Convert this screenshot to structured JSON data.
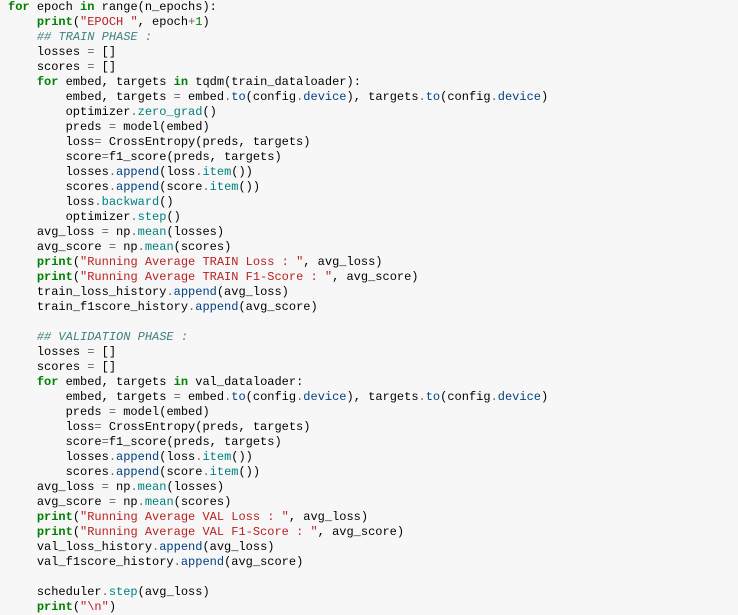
{
  "lines": [
    {
      "indent": 0,
      "tokens": [
        {
          "t": "for ",
          "c": "kw"
        },
        {
          "t": "epoch "
        },
        {
          "t": "in ",
          "c": "kw"
        },
        {
          "t": "range(n_epochs):"
        }
      ]
    },
    {
      "indent": 1,
      "tokens": [
        {
          "t": "print",
          "c": "kw"
        },
        {
          "t": "("
        },
        {
          "t": "\"EPOCH \"",
          "c": "str"
        },
        {
          "t": ", epoch"
        },
        {
          "t": "+",
          "c": "op"
        },
        {
          "t": "1",
          "c": "num"
        },
        {
          "t": ")"
        }
      ]
    },
    {
      "indent": 1,
      "tokens": [
        {
          "t": "## TRAIN PHASE :",
          "c": "cmt"
        }
      ]
    },
    {
      "indent": 1,
      "tokens": [
        {
          "t": "losses "
        },
        {
          "t": "=",
          "c": "op"
        },
        {
          "t": " []"
        }
      ]
    },
    {
      "indent": 1,
      "tokens": [
        {
          "t": "scores "
        },
        {
          "t": "=",
          "c": "op"
        },
        {
          "t": " []"
        }
      ]
    },
    {
      "indent": 1,
      "tokens": [
        {
          "t": "for ",
          "c": "kw"
        },
        {
          "t": "embed, targets "
        },
        {
          "t": "in ",
          "c": "kw"
        },
        {
          "t": "tqdm(train_dataloader):"
        }
      ]
    },
    {
      "indent": 2,
      "tokens": [
        {
          "t": "embed, targets "
        },
        {
          "t": "=",
          "c": "op"
        },
        {
          "t": " embed"
        },
        {
          "t": ".",
          "c": "op"
        },
        {
          "t": "to",
          "c": "attr"
        },
        {
          "t": "(config"
        },
        {
          "t": ".",
          "c": "op"
        },
        {
          "t": "device",
          "c": "attr"
        },
        {
          "t": "), targets"
        },
        {
          "t": ".",
          "c": "op"
        },
        {
          "t": "to",
          "c": "attr"
        },
        {
          "t": "(config"
        },
        {
          "t": ".",
          "c": "op"
        },
        {
          "t": "device",
          "c": "attr"
        },
        {
          "t": ")"
        }
      ]
    },
    {
      "indent": 2,
      "tokens": [
        {
          "t": "optimizer"
        },
        {
          "t": ".",
          "c": "op"
        },
        {
          "t": "zero_grad",
          "c": "teal"
        },
        {
          "t": "()"
        }
      ]
    },
    {
      "indent": 2,
      "tokens": [
        {
          "t": "preds "
        },
        {
          "t": "=",
          "c": "op"
        },
        {
          "t": " model(embed)"
        }
      ]
    },
    {
      "indent": 2,
      "tokens": [
        {
          "t": "loss"
        },
        {
          "t": "=",
          "c": "op"
        },
        {
          "t": " CrossEntropy(preds, targets)"
        }
      ]
    },
    {
      "indent": 2,
      "tokens": [
        {
          "t": "score"
        },
        {
          "t": "=",
          "c": "op"
        },
        {
          "t": "f1_score(preds, targets)"
        }
      ]
    },
    {
      "indent": 2,
      "tokens": [
        {
          "t": "losses"
        },
        {
          "t": ".",
          "c": "op"
        },
        {
          "t": "append",
          "c": "attr"
        },
        {
          "t": "(loss"
        },
        {
          "t": ".",
          "c": "op"
        },
        {
          "t": "item",
          "c": "teal"
        },
        {
          "t": "())"
        }
      ]
    },
    {
      "indent": 2,
      "tokens": [
        {
          "t": "scores"
        },
        {
          "t": ".",
          "c": "op"
        },
        {
          "t": "append",
          "c": "attr"
        },
        {
          "t": "(score"
        },
        {
          "t": ".",
          "c": "op"
        },
        {
          "t": "item",
          "c": "teal"
        },
        {
          "t": "())"
        }
      ]
    },
    {
      "indent": 2,
      "tokens": [
        {
          "t": "loss"
        },
        {
          "t": ".",
          "c": "op"
        },
        {
          "t": "backward",
          "c": "teal"
        },
        {
          "t": "()"
        }
      ]
    },
    {
      "indent": 2,
      "tokens": [
        {
          "t": "optimizer"
        },
        {
          "t": ".",
          "c": "op"
        },
        {
          "t": "step",
          "c": "teal"
        },
        {
          "t": "()"
        }
      ]
    },
    {
      "indent": 1,
      "tokens": [
        {
          "t": "avg_loss "
        },
        {
          "t": "=",
          "c": "op"
        },
        {
          "t": " np"
        },
        {
          "t": ".",
          "c": "op"
        },
        {
          "t": "mean",
          "c": "teal"
        },
        {
          "t": "(losses)"
        }
      ]
    },
    {
      "indent": 1,
      "tokens": [
        {
          "t": "avg_score "
        },
        {
          "t": "=",
          "c": "op"
        },
        {
          "t": " np"
        },
        {
          "t": ".",
          "c": "op"
        },
        {
          "t": "mean",
          "c": "teal"
        },
        {
          "t": "(scores)"
        }
      ]
    },
    {
      "indent": 1,
      "tokens": [
        {
          "t": "print",
          "c": "kw"
        },
        {
          "t": "("
        },
        {
          "t": "\"Running Average TRAIN Loss : \"",
          "c": "str"
        },
        {
          "t": ", avg_loss)"
        }
      ]
    },
    {
      "indent": 1,
      "tokens": [
        {
          "t": "print",
          "c": "kw"
        },
        {
          "t": "("
        },
        {
          "t": "\"Running Average TRAIN F1-Score : \"",
          "c": "str"
        },
        {
          "t": ", avg_score)"
        }
      ]
    },
    {
      "indent": 1,
      "tokens": [
        {
          "t": "train_loss_history"
        },
        {
          "t": ".",
          "c": "op"
        },
        {
          "t": "append",
          "c": "attr"
        },
        {
          "t": "(avg_loss)"
        }
      ]
    },
    {
      "indent": 1,
      "tokens": [
        {
          "t": "train_f1score_history"
        },
        {
          "t": ".",
          "c": "op"
        },
        {
          "t": "append",
          "c": "attr"
        },
        {
          "t": "(avg_score)"
        }
      ]
    },
    {
      "indent": 0,
      "tokens": [
        {
          "t": " "
        }
      ]
    },
    {
      "indent": 1,
      "tokens": [
        {
          "t": "## VALIDATION PHASE :",
          "c": "cmt"
        }
      ]
    },
    {
      "indent": 1,
      "tokens": [
        {
          "t": "losses "
        },
        {
          "t": "=",
          "c": "op"
        },
        {
          "t": " []"
        }
      ]
    },
    {
      "indent": 1,
      "tokens": [
        {
          "t": "scores "
        },
        {
          "t": "=",
          "c": "op"
        },
        {
          "t": " []"
        }
      ]
    },
    {
      "indent": 1,
      "tokens": [
        {
          "t": "for ",
          "c": "kw"
        },
        {
          "t": "embed, targets "
        },
        {
          "t": "in ",
          "c": "kw"
        },
        {
          "t": "val_dataloader:"
        }
      ]
    },
    {
      "indent": 2,
      "tokens": [
        {
          "t": "embed, targets "
        },
        {
          "t": "=",
          "c": "op"
        },
        {
          "t": " embed"
        },
        {
          "t": ".",
          "c": "op"
        },
        {
          "t": "to",
          "c": "attr"
        },
        {
          "t": "(config"
        },
        {
          "t": ".",
          "c": "op"
        },
        {
          "t": "device",
          "c": "attr"
        },
        {
          "t": "), targets"
        },
        {
          "t": ".",
          "c": "op"
        },
        {
          "t": "to",
          "c": "attr"
        },
        {
          "t": "(config"
        },
        {
          "t": ".",
          "c": "op"
        },
        {
          "t": "device",
          "c": "attr"
        },
        {
          "t": ")"
        }
      ]
    },
    {
      "indent": 2,
      "tokens": [
        {
          "t": "preds "
        },
        {
          "t": "=",
          "c": "op"
        },
        {
          "t": " model(embed)"
        }
      ]
    },
    {
      "indent": 2,
      "tokens": [
        {
          "t": "loss"
        },
        {
          "t": "=",
          "c": "op"
        },
        {
          "t": " CrossEntropy(preds, targets)"
        }
      ]
    },
    {
      "indent": 2,
      "tokens": [
        {
          "t": "score"
        },
        {
          "t": "=",
          "c": "op"
        },
        {
          "t": "f1_score(preds, targets)"
        }
      ]
    },
    {
      "indent": 2,
      "tokens": [
        {
          "t": "losses"
        },
        {
          "t": ".",
          "c": "op"
        },
        {
          "t": "append",
          "c": "attr"
        },
        {
          "t": "(loss"
        },
        {
          "t": ".",
          "c": "op"
        },
        {
          "t": "item",
          "c": "teal"
        },
        {
          "t": "())"
        }
      ]
    },
    {
      "indent": 2,
      "tokens": [
        {
          "t": "scores"
        },
        {
          "t": ".",
          "c": "op"
        },
        {
          "t": "append",
          "c": "attr"
        },
        {
          "t": "(score"
        },
        {
          "t": ".",
          "c": "op"
        },
        {
          "t": "item",
          "c": "teal"
        },
        {
          "t": "())"
        }
      ]
    },
    {
      "indent": 1,
      "tokens": [
        {
          "t": "avg_loss "
        },
        {
          "t": "=",
          "c": "op"
        },
        {
          "t": " np"
        },
        {
          "t": ".",
          "c": "op"
        },
        {
          "t": "mean",
          "c": "teal"
        },
        {
          "t": "(losses)"
        }
      ]
    },
    {
      "indent": 1,
      "tokens": [
        {
          "t": "avg_score "
        },
        {
          "t": "=",
          "c": "op"
        },
        {
          "t": " np"
        },
        {
          "t": ".",
          "c": "op"
        },
        {
          "t": "mean",
          "c": "teal"
        },
        {
          "t": "(scores)"
        }
      ]
    },
    {
      "indent": 1,
      "tokens": [
        {
          "t": "print",
          "c": "kw"
        },
        {
          "t": "("
        },
        {
          "t": "\"Running Average VAL Loss : \"",
          "c": "str"
        },
        {
          "t": ", avg_loss)"
        }
      ]
    },
    {
      "indent": 1,
      "tokens": [
        {
          "t": "print",
          "c": "kw"
        },
        {
          "t": "("
        },
        {
          "t": "\"Running Average VAL F1-Score : \"",
          "c": "str"
        },
        {
          "t": ", avg_score)"
        }
      ]
    },
    {
      "indent": 1,
      "tokens": [
        {
          "t": "val_loss_history"
        },
        {
          "t": ".",
          "c": "op"
        },
        {
          "t": "append",
          "c": "attr"
        },
        {
          "t": "(avg_loss)"
        }
      ]
    },
    {
      "indent": 1,
      "tokens": [
        {
          "t": "val_f1score_history"
        },
        {
          "t": ".",
          "c": "op"
        },
        {
          "t": "append",
          "c": "attr"
        },
        {
          "t": "(avg_score)"
        }
      ]
    },
    {
      "indent": 0,
      "tokens": [
        {
          "t": " "
        }
      ]
    },
    {
      "indent": 1,
      "tokens": [
        {
          "t": "scheduler"
        },
        {
          "t": ".",
          "c": "op"
        },
        {
          "t": "step",
          "c": "teal"
        },
        {
          "t": "(avg_loss)"
        }
      ]
    },
    {
      "indent": 1,
      "tokens": [
        {
          "t": "print",
          "c": "kw"
        },
        {
          "t": "("
        },
        {
          "t": "\"\\n\"",
          "c": "str"
        },
        {
          "t": ")"
        }
      ]
    }
  ],
  "indent_unit": "    "
}
